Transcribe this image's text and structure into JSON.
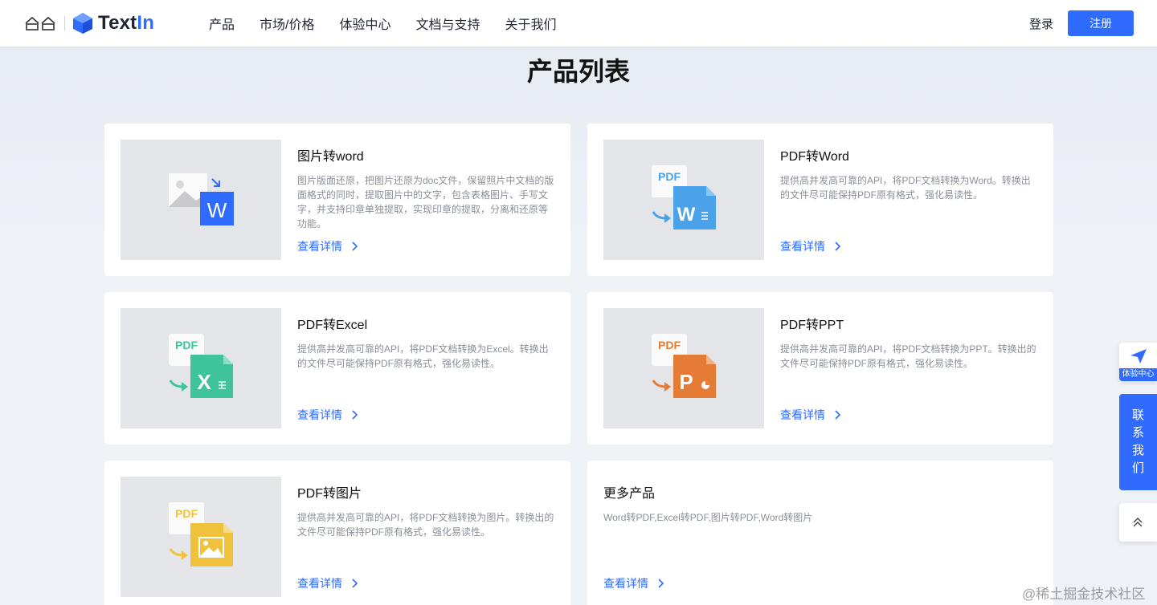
{
  "header": {
    "logo_text_1": "Text",
    "logo_text_2": "In",
    "nav": [
      "产品",
      "市场/价格",
      "体验中心",
      "文档与支持",
      "关于我们"
    ],
    "login_label": "登录",
    "register_label": "注册"
  },
  "page_title": "产品列表",
  "link_label": "查看详情",
  "cards": [
    {
      "title": "图片转word",
      "desc": "图片版面还原，把图片还原为doc文件，保留照片中文档的版面格式的同时，提取图片中的文字，包含表格图片、手写文字，并支持印章单独提取，实现印章的提取，分离和还原等功能。",
      "badge": "W",
      "icon": "image-to-word-icon"
    },
    {
      "title": "PDF转Word",
      "desc": "提供高并发高可靠的API，将PDF文档转换为Word。转换出的文件尽可能保持PDF原有格式，强化易读性。",
      "badge": "W",
      "tag": "PDF",
      "icon": "pdf-to-word-icon"
    },
    {
      "title": "PDF转Excel",
      "desc": "提供高并发高可靠的API，将PDF文档转换为Excel。转换出的文件尽可能保持PDF原有格式，强化易读性。",
      "badge": "X",
      "tag": "PDF",
      "icon": "pdf-to-excel-icon"
    },
    {
      "title": "PDF转PPT",
      "desc": "提供高并发高可靠的API，将PDF文档转换为PPT。转换出的文件尽可能保持PDF原有格式，强化易读性。",
      "badge": "P",
      "tag": "PDF",
      "icon": "pdf-to-ppt-icon"
    },
    {
      "title": "PDF转图片",
      "desc": "提供高并发高可靠的API，将PDF文档转换为图片。转换出的文件尽可能保持PDF原有格式，强化易读性。",
      "tag": "PDF",
      "icon": "pdf-to-image-icon"
    },
    {
      "title": "更多产品",
      "desc": "Word转PDF,Excel转PDF,图片转PDF,Word转图片"
    }
  ],
  "float": {
    "experience_label": "体验中心",
    "contact_chars": [
      "联",
      "系",
      "我",
      "们"
    ]
  },
  "watermark": "@稀土掘金技术社区",
  "colors": {
    "accent": "#2f6bff",
    "word": "#4aa3e8",
    "excel": "#3fc39a",
    "ppt": "#e57c35",
    "image": "#f0c23c"
  }
}
